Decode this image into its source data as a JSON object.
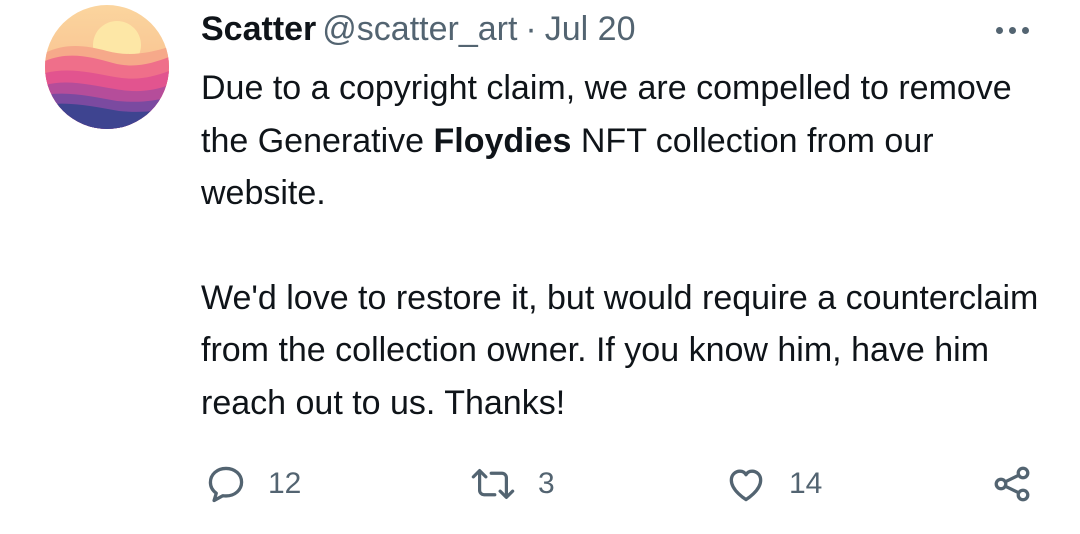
{
  "tweet": {
    "author_name": "Scatter",
    "author_handle": "@scatter_art",
    "separator": "·",
    "date": "Jul 20",
    "body": {
      "line1_before": "Due to a copyright claim, we are compelled to remove the Generative ",
      "line1_bold": "Floydies",
      "line1_after": " NFT collection from our website.",
      "paragraph2": "We'd love to restore it, but would require a counterclaim from the collection owner. If you know him, have him reach out to us. Thanks!"
    },
    "actions": {
      "reply_count": "12",
      "retweet_count": "3",
      "like_count": "14"
    }
  },
  "icons": {
    "avatar": "sunset-waves-logo",
    "more": "more-dots-icon",
    "reply": "reply-bubble-icon",
    "retweet": "retweet-icon",
    "like": "heart-icon",
    "share": "share-icon"
  },
  "colors": {
    "text_primary": "#0f1419",
    "text_secondary": "#536471"
  }
}
